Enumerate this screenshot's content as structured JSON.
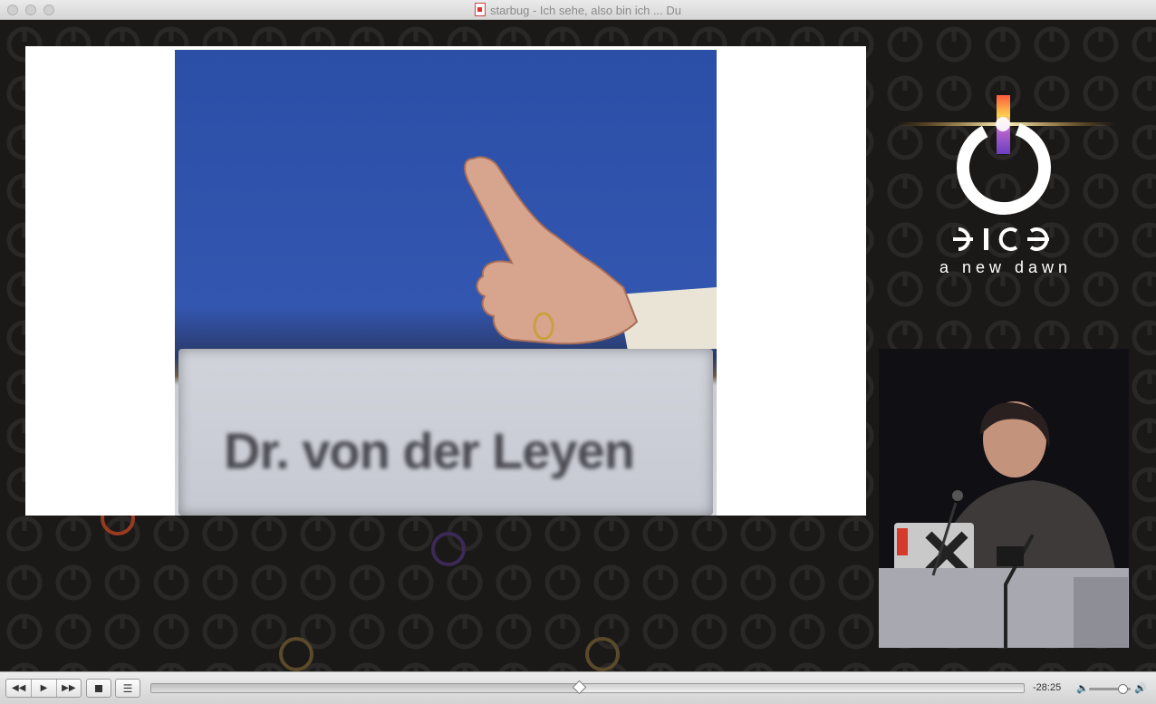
{
  "window": {
    "title": "starbug - Ich sehe, also bin ich ... Du"
  },
  "slide": {
    "nameplate_text": "Dr. von der Leyen"
  },
  "branding": {
    "logo_letters": "ƎICƎ",
    "tagline": "a new dawn"
  },
  "controls": {
    "rewind_icon": "rewind-icon",
    "play_icon": "play-icon",
    "fastforward_icon": "fast-forward-icon",
    "stop_icon": "stop-icon",
    "playlist_icon": "playlist-icon",
    "remaining_time": "-28:25",
    "progress_fraction": 0.49,
    "volume_fraction": 0.8
  },
  "colors": {
    "accent_orange": "#f0a020",
    "accent_purple": "#6a3fbf",
    "background": "#1b1918"
  }
}
